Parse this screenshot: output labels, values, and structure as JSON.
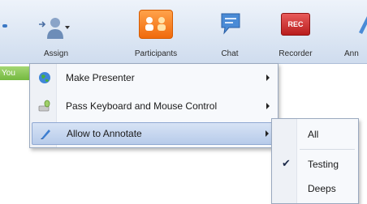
{
  "toolbar": {
    "assign_label": "Assign",
    "participants_label": "Participants",
    "chat_label": "Chat",
    "recorder_label": "Recorder",
    "recorder_badge": "REC",
    "more_label": "Ann"
  },
  "side_tab": {
    "label": "You"
  },
  "context_menu": {
    "items": [
      {
        "label": "Make Presenter",
        "icon": "globe-icon",
        "has_submenu": true
      },
      {
        "label": "Pass Keyboard and Mouse Control",
        "icon": "keyboard-mouse-icon",
        "has_submenu": true
      },
      {
        "label": "Allow to Annotate",
        "icon": "pen-icon",
        "has_submenu": true,
        "highlighted": true
      }
    ]
  },
  "annotate_submenu": {
    "items": [
      {
        "label": "All",
        "checked": false
      },
      {
        "label": "Testing",
        "checked": true
      },
      {
        "label": "Deeps",
        "checked": false
      }
    ],
    "check_glyph": "✔"
  },
  "colors": {
    "highlight": "#b7cbea",
    "ribbon": "#dde7f4",
    "participants_accent": "#f06a0c",
    "recorder_accent": "#b91d1d"
  }
}
